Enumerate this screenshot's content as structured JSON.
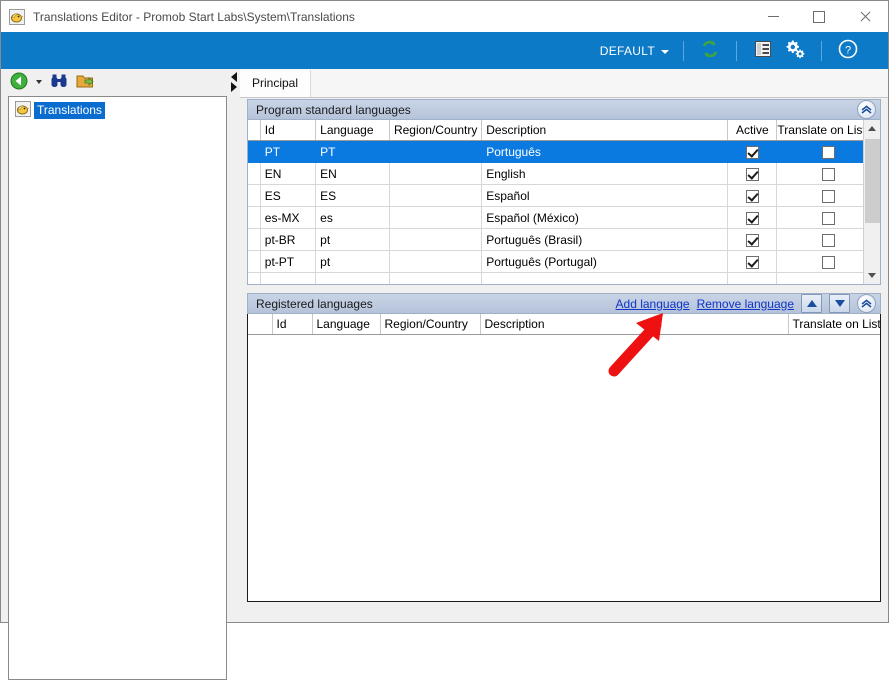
{
  "window": {
    "title": "Translations Editor - Promob Start Labs\\System\\Translations",
    "app_icon": "translations-app-icon",
    "controls": {
      "minimize": "minimize",
      "maximize": "maximize",
      "close": "close"
    }
  },
  "ribbon": {
    "profile_label": "DEFAULT",
    "buttons": [
      {
        "name": "refresh-icon",
        "title": "Refresh"
      },
      {
        "name": "list-view-icon",
        "title": "List"
      },
      {
        "name": "settings-gears-icon",
        "title": "Settings"
      },
      {
        "name": "help-icon",
        "title": "Help"
      }
    ],
    "accent_color": "#0d7ac8"
  },
  "sidebar": {
    "toolbar": [
      {
        "name": "back-icon",
        "title": "Back"
      },
      {
        "name": "find-binoculars-icon",
        "title": "Find"
      },
      {
        "name": "export-folder-icon",
        "title": "Export"
      }
    ],
    "tree": [
      {
        "label": "Translations",
        "icon": "translations-node-icon",
        "selected": true
      }
    ]
  },
  "main": {
    "tabs": [
      {
        "label": "Principal",
        "active": true
      }
    ],
    "sections": [
      {
        "title": "Program standard languages",
        "collapse_button": "collapse-icon",
        "columns": [
          "Id",
          "Language",
          "Region/Country",
          "Description",
          "Active",
          "Translate on Listing"
        ],
        "rows": [
          {
            "id": "PT",
            "language": "PT",
            "region": "",
            "description": "Português",
            "active": true,
            "translate_on_listing": false,
            "selected": true
          },
          {
            "id": "EN",
            "language": "EN",
            "region": "",
            "description": "English",
            "active": true,
            "translate_on_listing": false,
            "selected": false
          },
          {
            "id": "ES",
            "language": "ES",
            "region": "",
            "description": "Español",
            "active": true,
            "translate_on_listing": false,
            "selected": false
          },
          {
            "id": "es-MX",
            "language": "es",
            "region": "",
            "description": "Español (México)",
            "active": true,
            "translate_on_listing": false,
            "selected": false
          },
          {
            "id": "pt-BR",
            "language": "pt",
            "region": "",
            "description": "Português (Brasil)",
            "active": true,
            "translate_on_listing": false,
            "selected": false
          },
          {
            "id": "pt-PT",
            "language": "pt",
            "region": "",
            "description": "Português (Portugal)",
            "active": true,
            "translate_on_listing": false,
            "selected": false
          }
        ]
      },
      {
        "title": "Registered languages",
        "links": [
          {
            "label": "Add language",
            "name": "add-language-link"
          },
          {
            "label": "Remove language",
            "name": "remove-language-link"
          }
        ],
        "buttons": [
          {
            "name": "move-up-button",
            "title": "Move up"
          },
          {
            "name": "move-down-button",
            "title": "Move down"
          },
          {
            "name": "collapse-button",
            "title": "Collapse"
          }
        ],
        "columns": [
          "Id",
          "Language",
          "Region/Country",
          "Description",
          "Translate on Listing"
        ],
        "rows": []
      }
    ]
  },
  "annotation": {
    "arrow": "red-pointer-arrow",
    "color": "#ee1111",
    "points_to": "Add language"
  }
}
